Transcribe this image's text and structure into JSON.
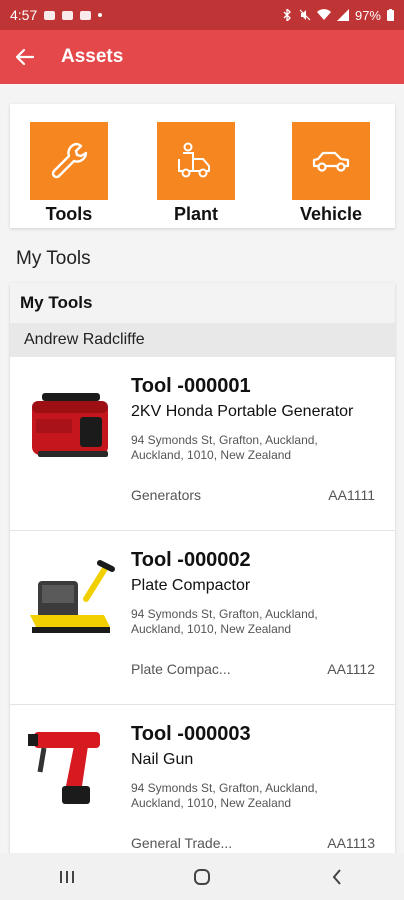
{
  "status_bar": {
    "time": "4:57",
    "battery": "97%"
  },
  "app_bar": {
    "title": "Assets"
  },
  "categories": [
    {
      "label": "Tools",
      "icon": "wrench-icon"
    },
    {
      "label": "Plant",
      "icon": "truck-icon"
    },
    {
      "label": "Vehicle",
      "icon": "car-icon"
    }
  ],
  "section_heading": "My Tools",
  "list": {
    "header": "My Tools",
    "group": "Andrew Radcliffe",
    "tools": [
      {
        "id": "Tool -000001",
        "name": "2KV Honda Portable Generator",
        "address": "94 Symonds St, Grafton, Auckland, Auckland, 1010, New Zealand",
        "category": "Generators",
        "code": "AA1111"
      },
      {
        "id": "Tool -000002",
        "name": "Plate Compactor",
        "address": "94 Symonds St, Grafton, Auckland, Auckland, 1010, New Zealand",
        "category": "Plate Compac...",
        "code": "AA1112"
      },
      {
        "id": "Tool -000003",
        "name": "Nail Gun",
        "address": "94 Symonds St, Grafton, Auckland, Auckland, 1010, New Zealand",
        "category": "General Trade...",
        "code": "AA1113"
      }
    ]
  },
  "colors": {
    "status_bar": "#bf3434",
    "app_bar": "#e5484a",
    "accent_orange": "#f6861f"
  }
}
